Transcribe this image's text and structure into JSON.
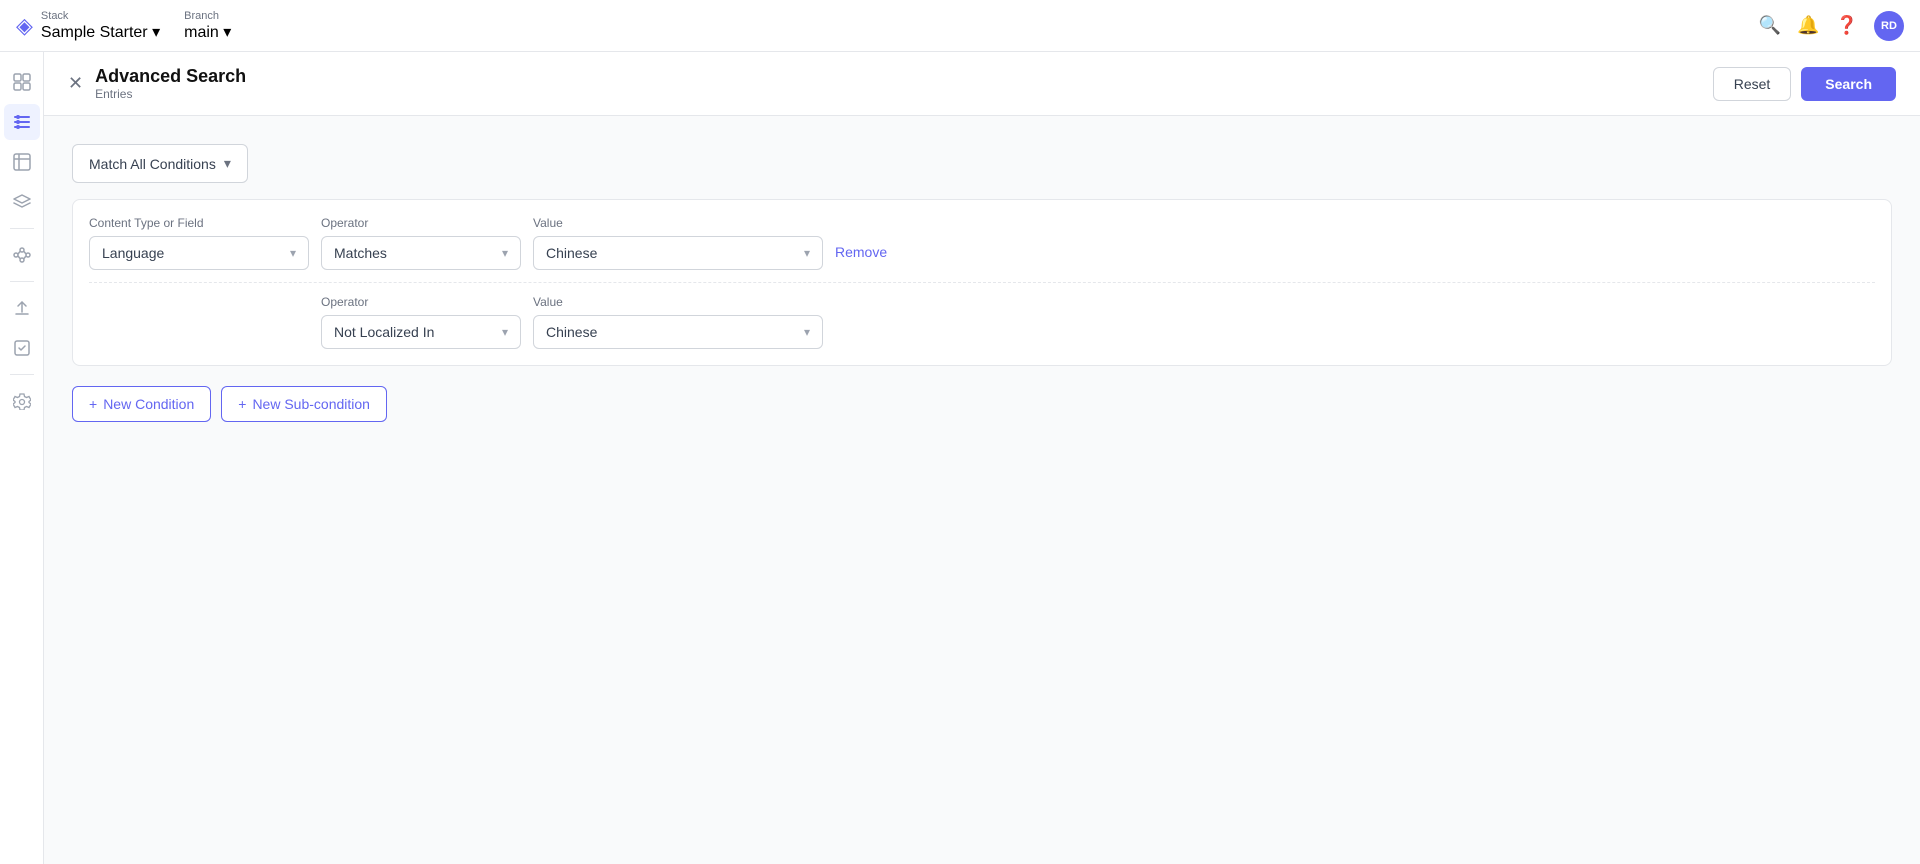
{
  "topNav": {
    "logoIcon": "◈",
    "stackLabel": "Stack",
    "stackName": "Sample Starter",
    "branchLabel": "Branch",
    "branchName": "main",
    "navIcons": [
      "search",
      "bell",
      "help"
    ],
    "avatarText": "RD"
  },
  "sidebar": {
    "items": [
      {
        "id": "dashboard",
        "icon": "⊞",
        "active": false
      },
      {
        "id": "list",
        "icon": "☰",
        "active": true
      },
      {
        "id": "fields",
        "icon": "⊟",
        "active": false
      },
      {
        "id": "layers",
        "icon": "⧉",
        "active": false
      },
      {
        "id": "connections",
        "icon": "⋯",
        "active": false
      },
      {
        "id": "deploy",
        "icon": "⬆",
        "active": false
      },
      {
        "id": "tasks",
        "icon": "☑",
        "active": false
      },
      {
        "id": "settings",
        "icon": "⚙",
        "active": false
      }
    ]
  },
  "header": {
    "title": "Advanced Search",
    "subtitle": "Entries",
    "resetLabel": "Reset",
    "searchLabel": "Search"
  },
  "search": {
    "matchDropdownLabel": "Match All Conditions",
    "columns": {
      "contentTypeLabel": "Content Type or Field",
      "operatorLabel": "Operator",
      "valueLabel": "Value"
    },
    "condition": {
      "contentType": "Language",
      "operator1": "Matches",
      "value1": "Chinese",
      "removeLabel": "Remove",
      "operator2Label": "Operator",
      "operator2": "Not Localized In",
      "value2Label": "Value",
      "value2": "Chinese"
    },
    "newConditionLabel": "New Condition",
    "newSubConditionLabel": "New Sub-condition",
    "plusIcon": "+"
  }
}
